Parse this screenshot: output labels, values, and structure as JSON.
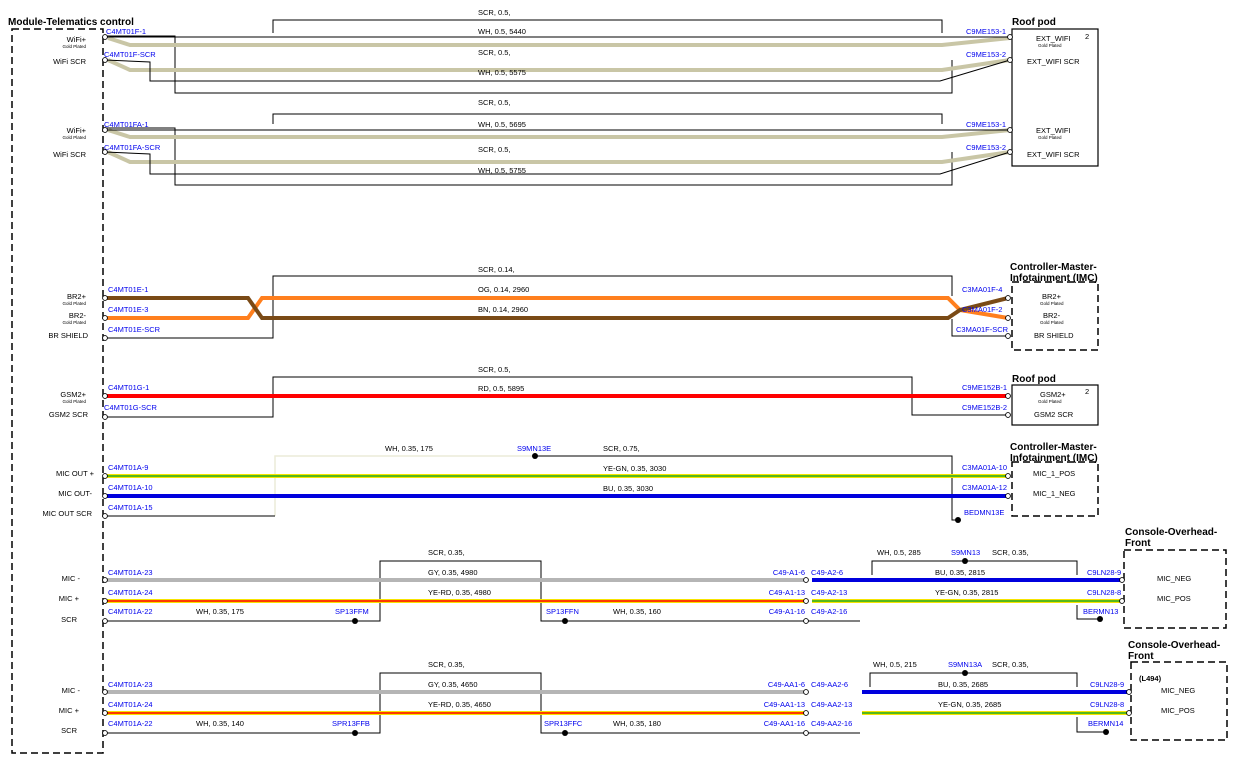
{
  "module": {
    "title": "Module-Telematics control"
  },
  "roof_pod_1": {
    "title": "Roof pod",
    "badge": "2",
    "pins": [
      {
        "label": "EXT_WIFI",
        "sub": "Gold Plated"
      },
      {
        "label": "EXT_WIFI SCR",
        "sub": ""
      },
      {
        "label": "EXT_WIFI",
        "sub": "Gold Plated"
      },
      {
        "label": "EXT_WIFI SCR",
        "sub": ""
      }
    ]
  },
  "imc_1": {
    "title_l1": "Controller-Master-",
    "title_l2": "Infotainment (IMC)",
    "pins": [
      {
        "label": "BR2+",
        "sub": "Gold Plated"
      },
      {
        "label": "BR2-",
        "sub": "Gold Plated"
      },
      {
        "label": "BR SHIELD",
        "sub": ""
      }
    ]
  },
  "roof_pod_2": {
    "title": "Roof pod",
    "badge": "2",
    "pins": [
      {
        "label": "GSM2+",
        "sub": "Gold Plated"
      },
      {
        "label": "GSM2 SCR",
        "sub": ""
      }
    ]
  },
  "imc_2": {
    "title_l1": "Controller-Master-",
    "title_l2": "Infotainment (IMC)",
    "pins": [
      {
        "label": "MIC_1_POS",
        "sub": ""
      },
      {
        "label": "MIC_1_NEG",
        "sub": ""
      }
    ]
  },
  "overhead_1": {
    "title_l1": "Console-Overhead-",
    "title_l2": "Front",
    "option": "",
    "pins": [
      {
        "label": "MIC_NEG"
      },
      {
        "label": "MIC_POS"
      }
    ]
  },
  "overhead_2": {
    "title_l1": "Console-Overhead-",
    "title_l2": "Front",
    "option": "(L494)",
    "pins": [
      {
        "label": "MIC_NEG"
      },
      {
        "label": "MIC_POS"
      }
    ]
  },
  "left_pins": [
    {
      "label": "WiFi+",
      "sub": "Gold Plated"
    },
    {
      "label": "WiFi SCR",
      "sub": ""
    },
    {
      "label": "WiFi+",
      "sub": "Gold Plated"
    },
    {
      "label": "WiFi SCR",
      "sub": ""
    },
    {
      "label": "BR2+",
      "sub": "Gold Plated"
    },
    {
      "label": "BR2-",
      "sub": "Gold Plated"
    },
    {
      "label": "BR SHIELD",
      "sub": ""
    },
    {
      "label": "GSM2+",
      "sub": "Gold Plated"
    },
    {
      "label": "GSM2 SCR",
      "sub": ""
    },
    {
      "label": "MIC OUT +",
      "sub": ""
    },
    {
      "label": "MIC OUT-",
      "sub": ""
    },
    {
      "label": "MIC OUT SCR",
      "sub": ""
    },
    {
      "label": "MIC -",
      "sub": ""
    },
    {
      "label": "MIC +",
      "sub": ""
    },
    {
      "label": "SCR",
      "sub": ""
    },
    {
      "label": "MIC -",
      "sub": ""
    },
    {
      "label": "MIC +",
      "sub": ""
    },
    {
      "label": "SCR",
      "sub": ""
    }
  ],
  "connectors": {
    "c4mt01f_1": "C4MT01F-1",
    "c4mt01f_scr": "C4MT01F-SCR",
    "c9me153_1a": "C9ME153-1",
    "c9me153_2a": "C9ME153-2",
    "c4mt01fa_1": "C4MT01FA-1",
    "c4mt01fa_scr": "C4MT01FA-SCR",
    "c9me153_1b": "C9ME153-1",
    "c9me153_2b": "C9ME153-2",
    "c4mt01e_1": "C4MT01E-1",
    "c4mt01e_3": "C4MT01E-3",
    "c4mt01e_scr": "C4MT01E-SCR",
    "c3ma01f_4": "C3MA01F-4",
    "c3ma01f_2": "C3MA01F-2",
    "c3ma01f_scr": "C3MA01F-SCR",
    "c4mt01g_1": "C4MT01G-1",
    "c4mt01g_scr": "C4MT01G-SCR",
    "c9me152b_1": "C9ME152B-1",
    "c9me152b_2": "C9ME152B-2",
    "c4mt01a_9": "C4MT01A-9",
    "c4mt01a_10": "C4MT01A-10",
    "c4mt01a_15": "C4MT01A-15",
    "c3ma01a_10": "C3MA01A-10",
    "c3ma01a_12": "C3MA01A-12",
    "bedmn13e": "BEDMN13E",
    "s9mn13e": "S9MN13E",
    "c4mt01a_23a": "C4MT01A-23",
    "c4mt01a_24a": "C4MT01A-24",
    "c4mt01a_22a": "C4MT01A-22",
    "sp13ffm": "SP13FFM",
    "sp13ffn": "SP13FFN",
    "c49a1_6": "C49-A1-6",
    "c49a1_13": "C49-A1-13",
    "c49a1_16": "C49-A1-16",
    "c49a2_6": "C49-A2-6",
    "c49a2_13": "C49-A2-13",
    "c49a2_16": "C49-A2-16",
    "s9mn13": "S9MN13",
    "c9ln28_9a": "C9LN28-9",
    "c9ln28_8a": "C9LN28-8",
    "bermn13": "BERMN13",
    "c4mt01a_23b": "C4MT01A-23",
    "c4mt01a_24b": "C4MT01A-24",
    "c4mt01a_22b": "C4MT01A-22",
    "spr13ffb": "SPR13FFB",
    "spr13ffc": "SPR13FFC",
    "c49aa1_6": "C49-AA1-6",
    "c49aa1_13": "C49-AA1-13",
    "c49aa1_16": "C49-AA1-16",
    "c49aa2_6": "C49-AA2-6",
    "c49aa2_13": "C49-AA2-13",
    "c49aa2_16": "C49-AA2-16",
    "s9mn13a": "S9MN13A",
    "c9ln28_9b": "C9LN28-9",
    "c9ln28_8b": "C9LN28-8",
    "bermn14": "BERMN14"
  },
  "wire_labels": {
    "w1_scr": "SCR,  0.5,",
    "w1_wh": "WH,  0.5,  5440",
    "w2_scr": "SCR,  0.5,",
    "w2_wh": "WH,  0.5,  5575",
    "w3_scr": "SCR,  0.5,",
    "w3_wh": "WH,  0.5,  5695",
    "w4_scr": "SCR,  0.5,",
    "w4_wh": "WH,  0.5,  5755",
    "br_scr": "SCR,  0.14,",
    "br_og": "OG,  0.14,  2960",
    "br_bn": "BN,  0.14,  2960",
    "gsm_scr": "SCR,  0.5,",
    "gsm_rd": "RD,  0.5,  5895",
    "mo_wh": "WH,  0.35,  175",
    "mo_scr": "SCR,  0.75,",
    "mo_yegn": "YE-GN,  0.35,  3030",
    "mo_bu": "BU,  0.35,  3030",
    "m1_scr": "SCR,  0.35,",
    "m1_gy": "GY,  0.35,  4980",
    "m1_yerd": "YE-RD,  0.35,  4980",
    "m1_wh1": "WH,  0.35,  175",
    "m1_wh2": "WH,  0.35,  160",
    "m1_wh3": "WH,  0.5,  285",
    "m1_scr2": "SCR,  0.35,",
    "m1_bu": "BU,  0.35,  2815",
    "m1_yegn": "YE-GN,  0.35,  2815",
    "m2_scr": "SCR,  0.35,",
    "m2_gy": "GY,  0.35,  4650",
    "m2_yerd": "YE-RD,  0.35,  4650",
    "m2_wh1": "WH,  0.35,  140",
    "m2_wh2": "WH,  0.35,  180",
    "m2_wh3": "WH,  0.5,  215",
    "m2_scr2": "SCR,  0.35,",
    "m2_bu": "BU,  0.35,  2685",
    "m2_yegn": "YE-GN,  0.35,  2685"
  },
  "colors": {
    "orange": "#ff7f1e",
    "brown": "#7a4a16",
    "red": "#ff0000",
    "blue": "#0000dd",
    "gray": "#b5b5b5",
    "yellow": "#f6e400",
    "green": "#22aa22",
    "scr_tan": "#c9c6a6"
  }
}
